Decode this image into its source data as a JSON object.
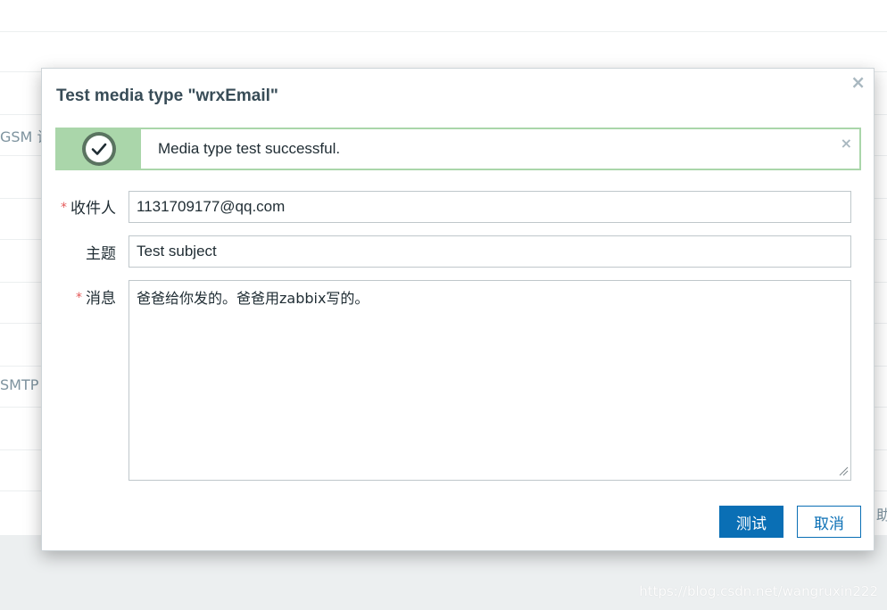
{
  "background": {
    "row_fragments": [
      "GSM 设",
      "SMTP"
    ],
    "right_fragment": "助"
  },
  "watermark": "https://blog.csdn.net/wangruxin222",
  "dialog": {
    "title": "Test media type \"wrxEmail\"",
    "close_glyph": "×",
    "message": {
      "text": "Media type test successful.",
      "status": "success",
      "icon": "check-circle-icon",
      "close_glyph": "×",
      "colors": {
        "border": "#aad6aa",
        "icon_bg": "#5a7360"
      }
    },
    "form": {
      "recipient": {
        "label": "收件人",
        "required": "*",
        "value": "1131709177@qq.com"
      },
      "subject": {
        "label": "主题",
        "value": "Test subject"
      },
      "message": {
        "label": "消息",
        "required": "*",
        "value": "爸爸给你发的。爸爸用zabbix写的。"
      }
    },
    "buttons": {
      "test": "测试",
      "cancel": "取消"
    }
  },
  "colors": {
    "primary": "#0a6fb5",
    "required": "#e45959"
  }
}
